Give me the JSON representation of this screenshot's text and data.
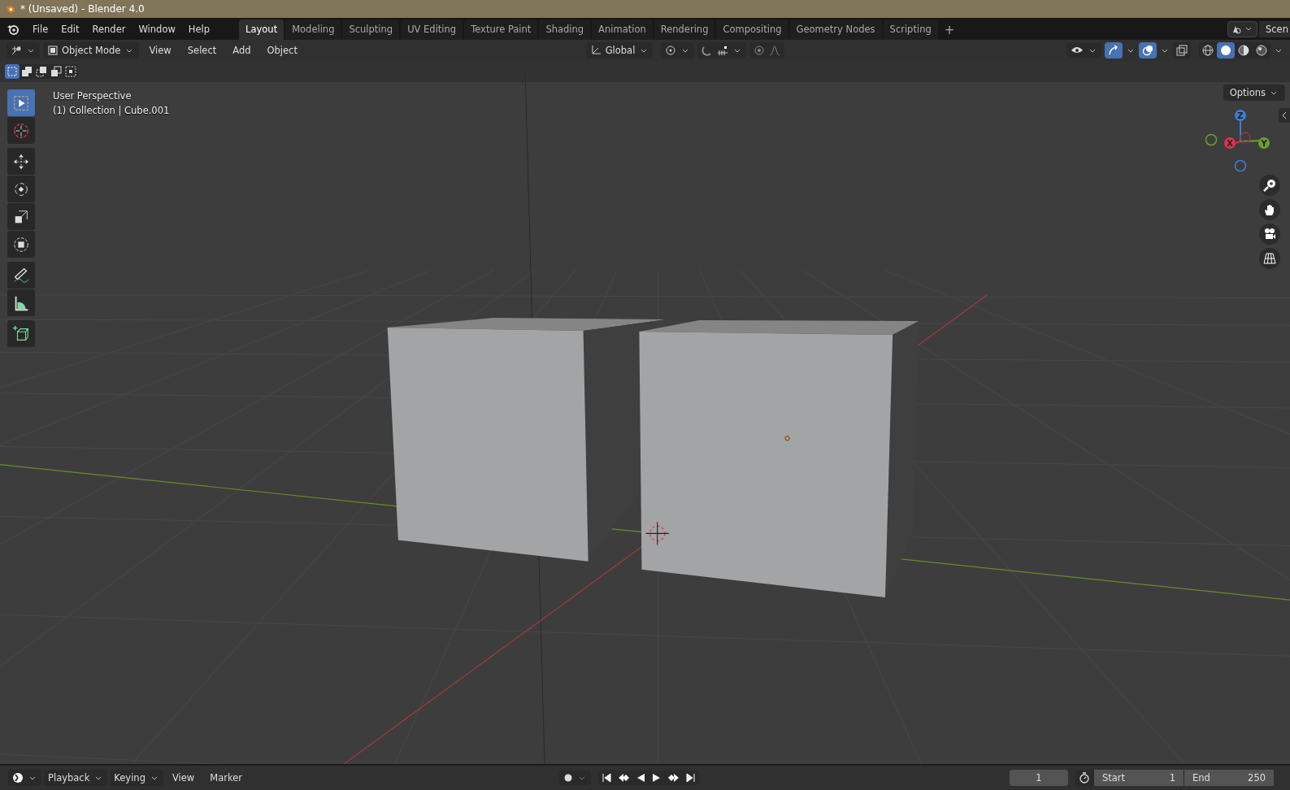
{
  "window": {
    "title": "* (Unsaved) - Blender 4.0"
  },
  "menu": [
    "File",
    "Edit",
    "Render",
    "Window",
    "Help"
  ],
  "workspace_tabs": [
    {
      "label": "Layout",
      "selected": true
    },
    {
      "label": "Modeling",
      "selected": false
    },
    {
      "label": "Sculpting",
      "selected": false
    },
    {
      "label": "UV Editing",
      "selected": false
    },
    {
      "label": "Texture Paint",
      "selected": false
    },
    {
      "label": "Shading",
      "selected": false
    },
    {
      "label": "Animation",
      "selected": false
    },
    {
      "label": "Rendering",
      "selected": false
    },
    {
      "label": "Compositing",
      "selected": false
    },
    {
      "label": "Geometry Nodes",
      "selected": false
    },
    {
      "label": "Scripting",
      "selected": false
    }
  ],
  "add_tab": "+",
  "scene_field": "Scen",
  "header": {
    "mode": "Object Mode",
    "menus": [
      "View",
      "Select",
      "Add",
      "Object"
    ],
    "orientation": "Global"
  },
  "viewport_toggles": [
    {
      "kind": "gizmo",
      "on": true
    },
    {
      "kind": "overlay",
      "on": true
    },
    {
      "kind": "xray",
      "on": false
    }
  ],
  "shading_modes": [
    {
      "kind": "wireframe",
      "selected": false
    },
    {
      "kind": "solid",
      "selected": true
    },
    {
      "kind": "material",
      "selected": false
    },
    {
      "kind": "rendered",
      "selected": false
    }
  ],
  "select_modes": [
    {
      "kind": "set",
      "selected": true
    },
    {
      "kind": "extend",
      "selected": false
    },
    {
      "kind": "subtract",
      "selected": false
    },
    {
      "kind": "invert",
      "selected": false
    },
    {
      "kind": "intersect",
      "selected": false
    }
  ],
  "options_button": "Options",
  "toolbar": [
    {
      "kind": "select",
      "selected": true
    },
    {
      "kind": "cursor",
      "selected": false
    },
    {
      "kind": "move",
      "selected": false
    },
    {
      "kind": "rotate",
      "selected": false
    },
    {
      "kind": "scale",
      "selected": false
    },
    {
      "kind": "transform",
      "selected": false
    },
    {
      "kind": "annotate",
      "selected": false
    },
    {
      "kind": "measure",
      "selected": false
    },
    {
      "kind": "add-cube",
      "selected": false
    }
  ],
  "overlay": {
    "view_name": "User Perspective",
    "object_info": "(1) Collection | Cube.001"
  },
  "gizmo": {
    "x": "X",
    "y": "Y",
    "z": "Z"
  },
  "timeline": {
    "menus": [
      "Playback",
      "Keying",
      "View",
      "Marker"
    ],
    "current_frame": "1",
    "start_label": "Start",
    "start": "1",
    "end_label": "End",
    "end": "250"
  }
}
